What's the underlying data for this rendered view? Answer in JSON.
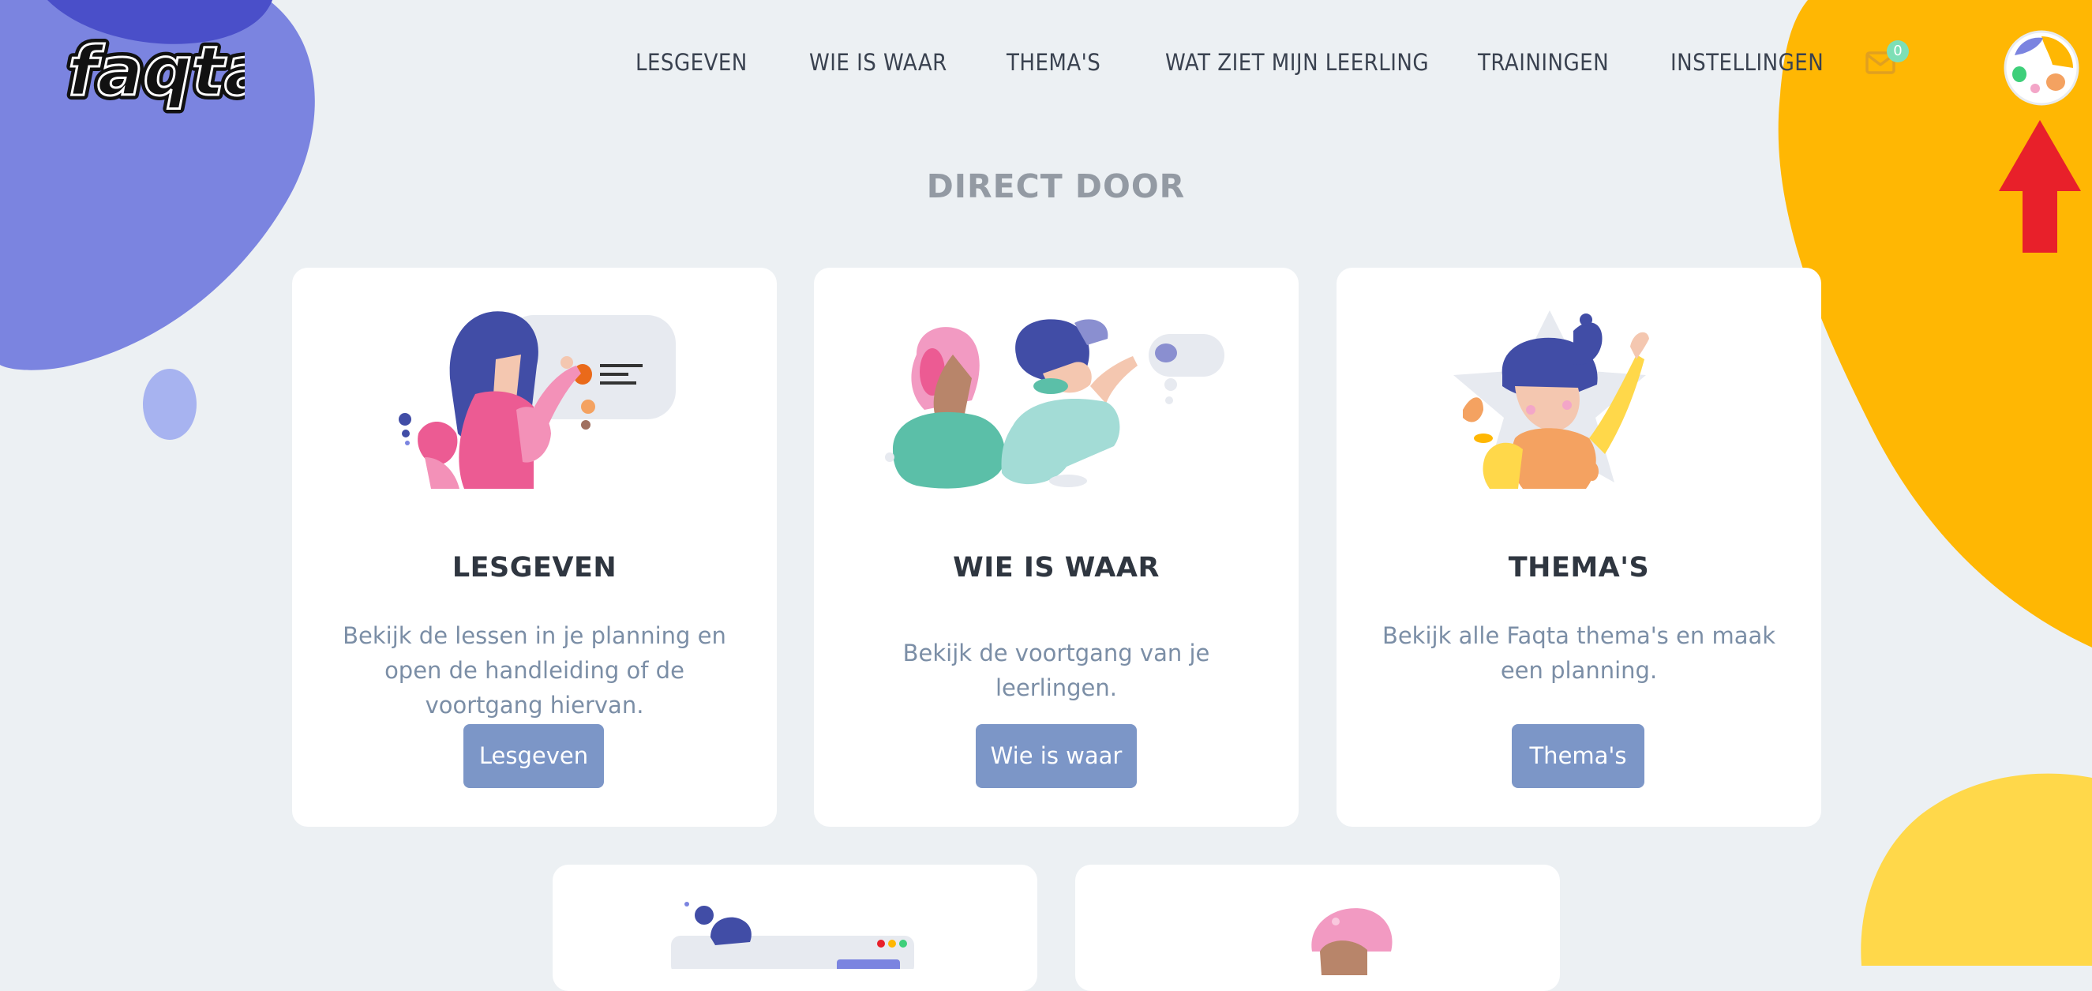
{
  "app": {
    "logo_text": "faqta"
  },
  "nav": {
    "items": [
      {
        "label": "LESGEVEN"
      },
      {
        "label": "WIE IS WAAR"
      },
      {
        "label": "THEMA'S"
      },
      {
        "label": "WAT ZIET MIJN LEERLING"
      },
      {
        "label": "TRAININGEN"
      },
      {
        "label": "INSTELLINGEN"
      }
    ],
    "mail_count": "0",
    "mail_icon": "envelope-icon",
    "avatar_icon": "user-avatar-icon"
  },
  "section": {
    "title": "DIRECT DOOR"
  },
  "cards": [
    {
      "title": "LESGEVEN",
      "description": "Bekijk de lessen in je planning en open de handleiding of de voortgang hiervan.",
      "button": "Lesgeven",
      "illustration": "teacher-board-illustration"
    },
    {
      "title": "WIE IS WAAR",
      "description": "Bekijk de voortgang van je leerlingen.",
      "button": "Wie is waar",
      "illustration": "students-illustration"
    },
    {
      "title": "THEMA'S",
      "description": "Bekijk alle Faqta thema's en maak een planning.",
      "button": "Thema's",
      "illustration": "star-kid-illustration"
    }
  ],
  "colors": {
    "background": "#ecf0f3",
    "button": "#7c96c7",
    "blob_purple": "#7b84e0",
    "blob_yellow": "#ffb703",
    "arrow_red": "#e8202a",
    "badge_green": "#7ddfb6"
  }
}
